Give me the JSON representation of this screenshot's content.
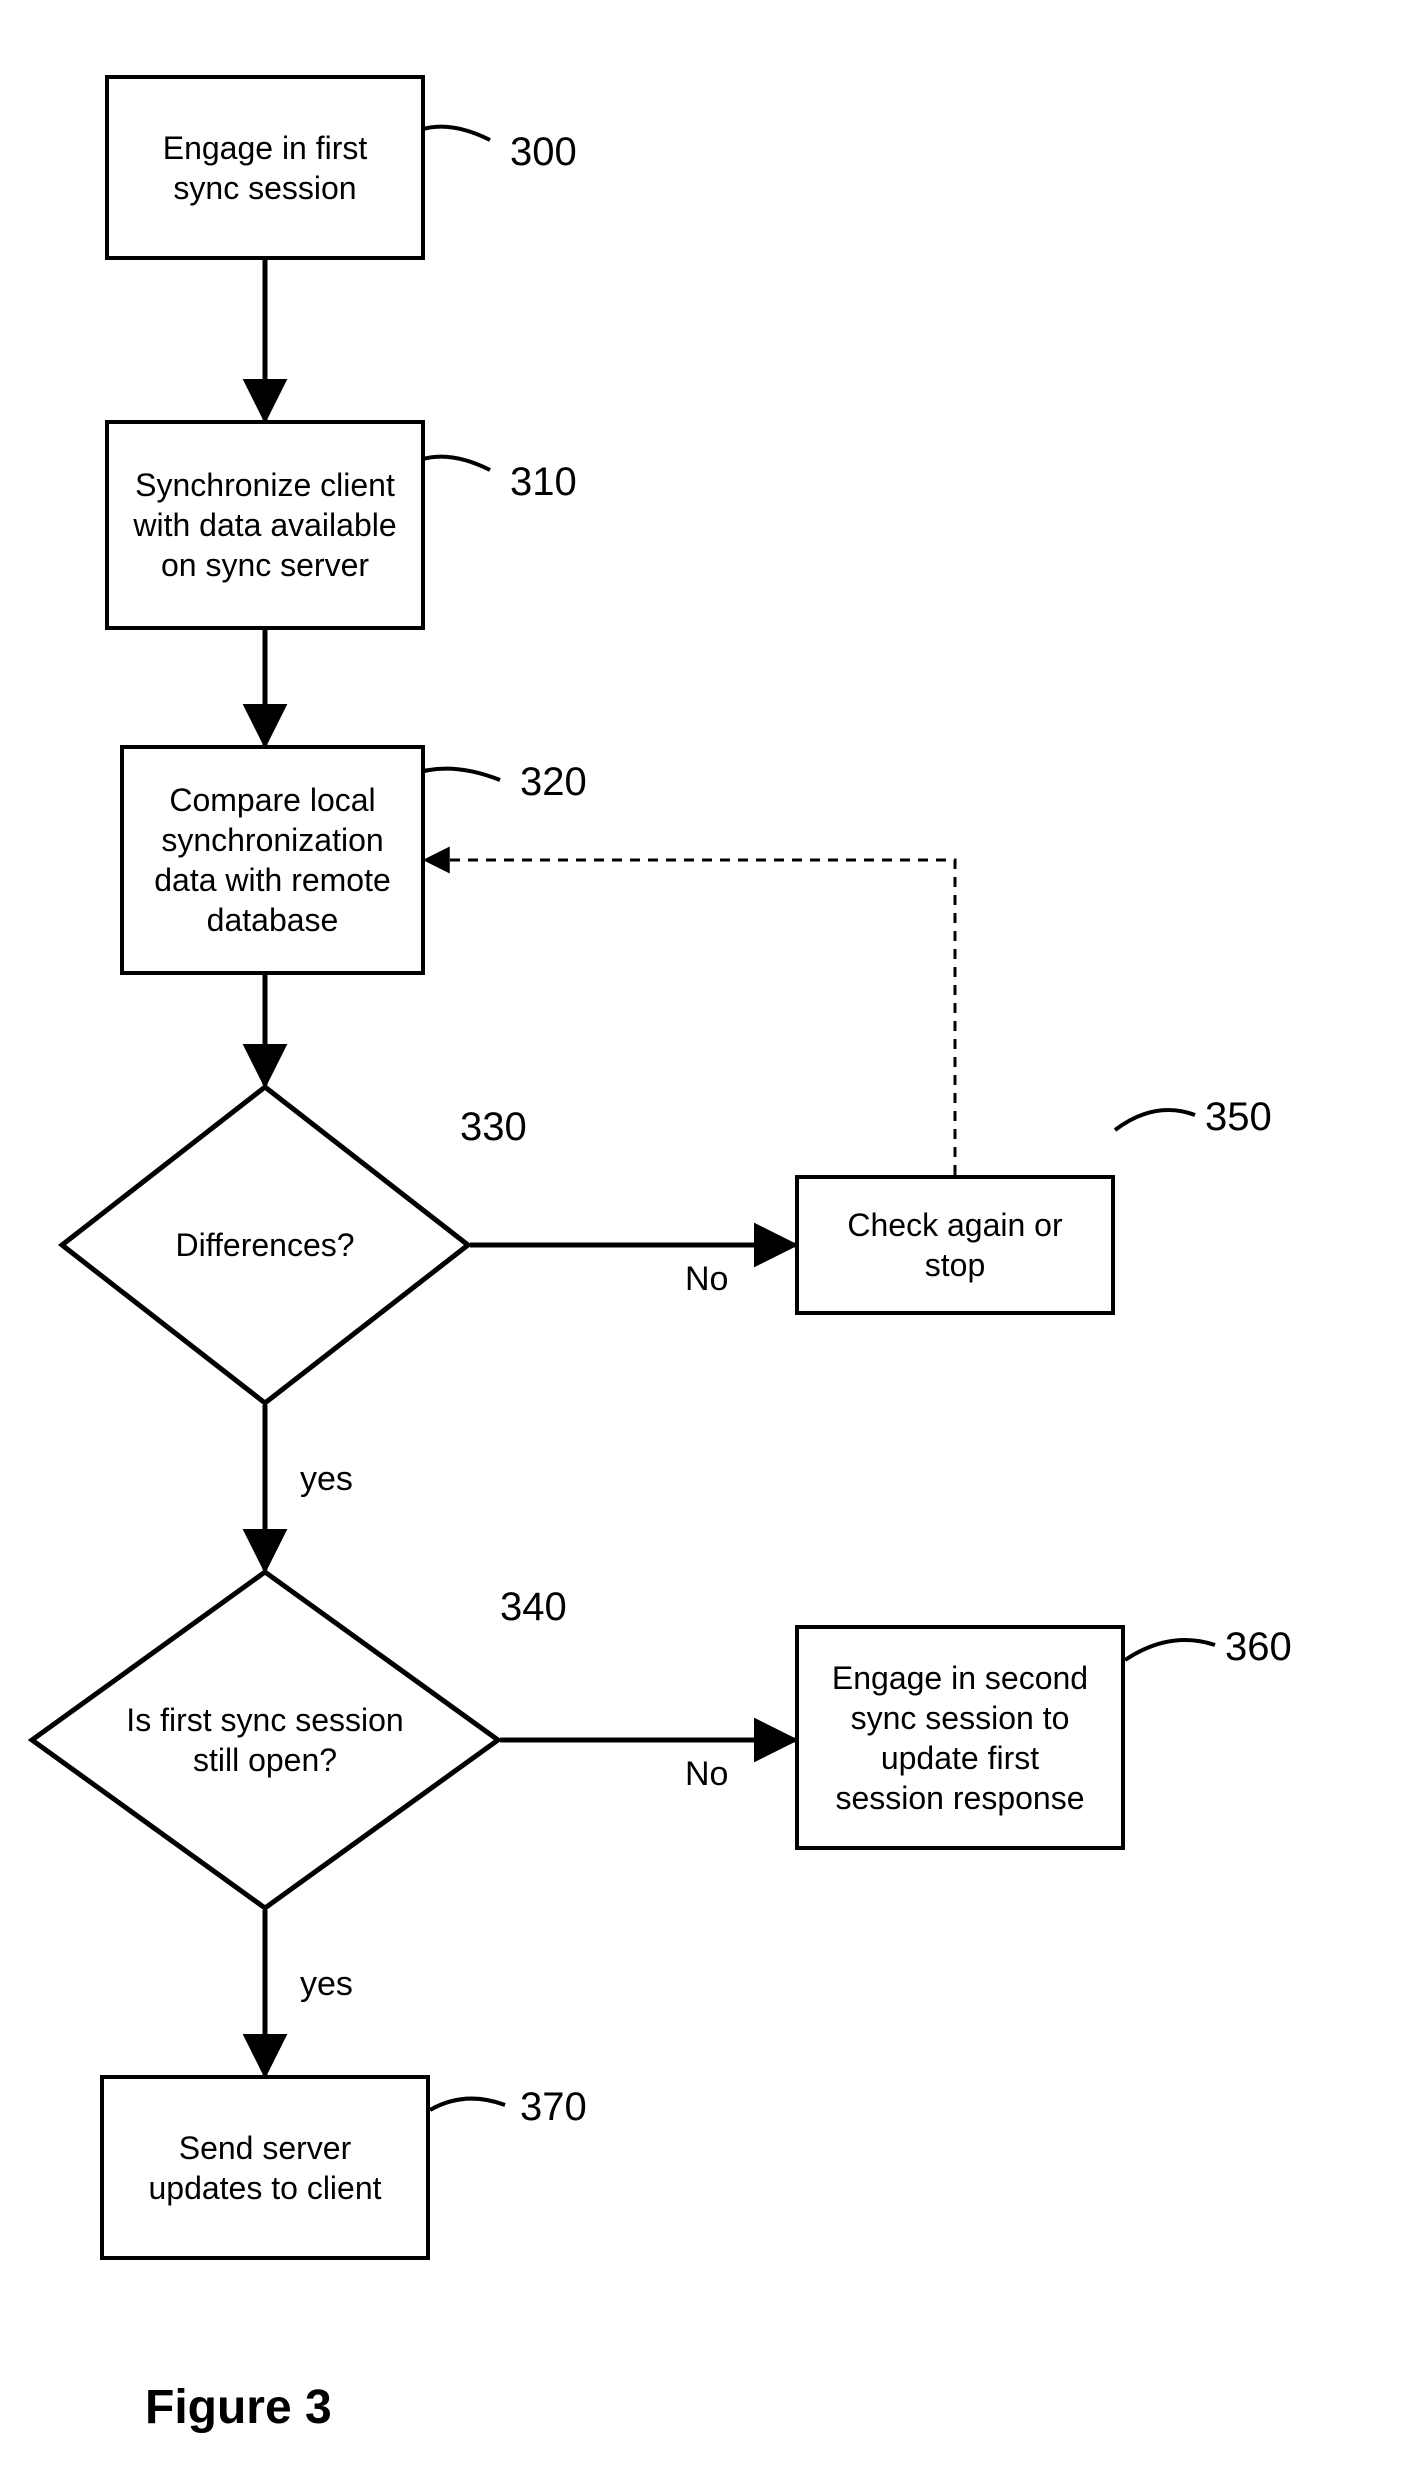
{
  "nodes": {
    "n300": {
      "text": "Engage in first\nsync session",
      "num": "300"
    },
    "n310": {
      "text": "Synchronize client\nwith data available\non sync server",
      "num": "310"
    },
    "n320": {
      "text": "Compare local\nsynchronization\ndata with remote\ndatabase",
      "num": "320"
    },
    "n330": {
      "text": "Differences?",
      "num": "330",
      "yes_label": "yes",
      "no_label": "No"
    },
    "n340": {
      "text": "Is first sync session\nstill open?",
      "num": "340",
      "yes_label": "yes",
      "no_label": "No"
    },
    "n350": {
      "text": "Check again or\nstop",
      "num": "350"
    },
    "n360": {
      "text": "Engage in second\nsync session to\nupdate first\nsession response",
      "num": "360"
    },
    "n370": {
      "text": "Send server\nupdates to client",
      "num": "370"
    }
  },
  "caption": "Figure 3"
}
